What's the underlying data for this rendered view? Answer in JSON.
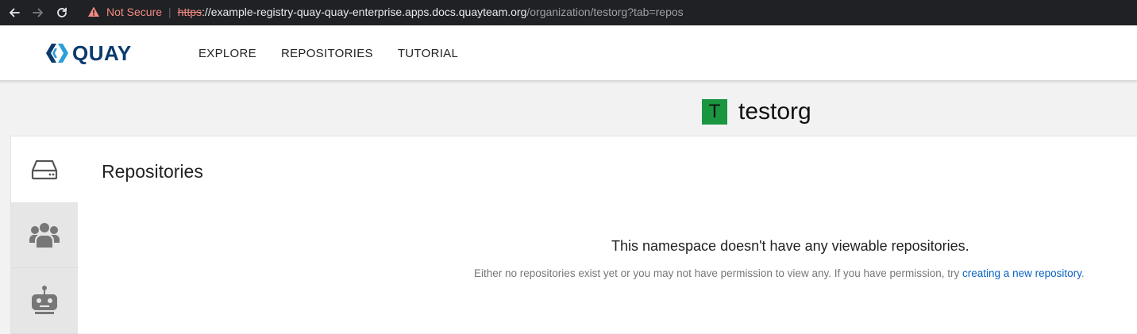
{
  "browser": {
    "security_label": "Not Secure",
    "url_scheme": "https",
    "url_sep": "://",
    "url_host": "example-registry-quay-quay-enterprise.apps.docs.quayteam.org",
    "url_path": "/organization/testorg?tab=repos"
  },
  "nav": {
    "brand": "QUAY",
    "links": [
      "EXPLORE",
      "REPOSITORIES",
      "TUTORIAL"
    ]
  },
  "org": {
    "avatar_letter": "T",
    "name": "testorg",
    "avatar_color": "#1a9641"
  },
  "tabs": {
    "items": [
      {
        "icon": "hard-drive-icon",
        "active": true
      },
      {
        "icon": "users-icon",
        "active": false
      },
      {
        "icon": "robot-icon",
        "active": false
      }
    ]
  },
  "repos": {
    "title": "Repositories",
    "empty_title": "This namespace doesn't have any viewable repositories.",
    "empty_desc": "Either no repositories exist yet or you may not have permission to view any. If you have permission, try ",
    "empty_link": "creating a new repository",
    "empty_end": "."
  }
}
